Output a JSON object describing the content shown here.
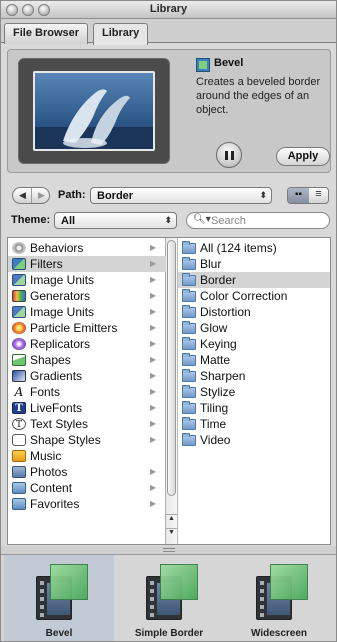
{
  "window": {
    "title": "Library"
  },
  "tabs": [
    {
      "label": "File Browser",
      "active": false
    },
    {
      "label": "Library",
      "active": true
    }
  ],
  "preview": {
    "item_title": "Bevel",
    "item_description": "Creates a beveled border around the edges of an object.",
    "apply_label": "Apply"
  },
  "path": {
    "label": "Path:",
    "value": "Border"
  },
  "theme": {
    "label": "Theme:",
    "value": "All"
  },
  "search": {
    "placeholder": "Search"
  },
  "categories": [
    {
      "label": "Behaviors",
      "icon": "gear-icon",
      "has_arrow": true,
      "selected": false
    },
    {
      "label": "Filters",
      "icon": "filters-icon",
      "has_arrow": true,
      "selected": true
    },
    {
      "label": "Image Units",
      "icon": "image-units-icon",
      "has_arrow": true,
      "selected": false
    },
    {
      "label": "Generators",
      "icon": "generators-icon",
      "has_arrow": true,
      "selected": false
    },
    {
      "label": "Image Units",
      "icon": "image-units-icon",
      "has_arrow": true,
      "selected": false
    },
    {
      "label": "Particle Emitters",
      "icon": "particle-emitters-icon",
      "has_arrow": true,
      "selected": false
    },
    {
      "label": "Replicators",
      "icon": "replicators-icon",
      "has_arrow": true,
      "selected": false
    },
    {
      "label": "Shapes",
      "icon": "shapes-icon",
      "has_arrow": true,
      "selected": false
    },
    {
      "label": "Gradients",
      "icon": "gradients-icon",
      "has_arrow": true,
      "selected": false
    },
    {
      "label": "Fonts",
      "icon": "fonts-icon",
      "has_arrow": true,
      "selected": false
    },
    {
      "label": "LiveFonts",
      "icon": "livefonts-icon",
      "has_arrow": true,
      "selected": false
    },
    {
      "label": "Text Styles",
      "icon": "text-styles-icon",
      "has_arrow": true,
      "selected": false
    },
    {
      "label": "Shape Styles",
      "icon": "shape-styles-icon",
      "has_arrow": true,
      "selected": false
    },
    {
      "label": "Music",
      "icon": "music-icon",
      "has_arrow": false,
      "selected": false
    },
    {
      "label": "Photos",
      "icon": "photos-icon",
      "has_arrow": true,
      "selected": false
    },
    {
      "label": "Content",
      "icon": "content-icon",
      "has_arrow": true,
      "selected": false
    },
    {
      "label": "Favorites",
      "icon": "favorites-icon",
      "has_arrow": true,
      "selected": false
    }
  ],
  "subfolders": [
    {
      "label": "All (124 items)",
      "selected": false
    },
    {
      "label": "Blur",
      "selected": false
    },
    {
      "label": "Border",
      "selected": true
    },
    {
      "label": "Color Correction",
      "selected": false
    },
    {
      "label": "Distortion",
      "selected": false
    },
    {
      "label": "Glow",
      "selected": false
    },
    {
      "label": "Keying",
      "selected": false
    },
    {
      "label": "Matte",
      "selected": false
    },
    {
      "label": "Sharpen",
      "selected": false
    },
    {
      "label": "Stylize",
      "selected": false
    },
    {
      "label": "Tiling",
      "selected": false
    },
    {
      "label": "Time",
      "selected": false
    },
    {
      "label": "Video",
      "selected": false
    }
  ],
  "presets": [
    {
      "label": "Bevel",
      "selected": true
    },
    {
      "label": "Simple Border",
      "selected": false
    },
    {
      "label": "Widescreen",
      "selected": false
    }
  ]
}
